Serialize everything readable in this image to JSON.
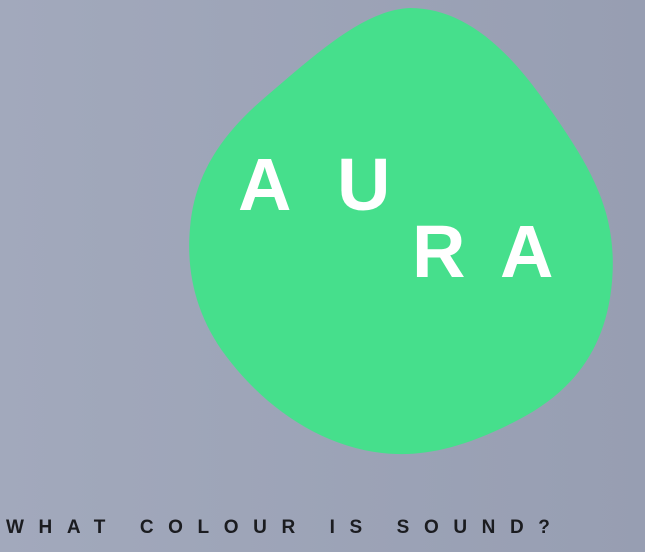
{
  "logo": {
    "letters": [
      "A",
      "U",
      "R",
      "A"
    ],
    "blob_color": "#46df8c",
    "text_color": "#ffffff"
  },
  "tagline": "WHAT COLOUR IS SOUND?",
  "colors": {
    "background_left": "#a2a9bc",
    "background_right": "#979eb2",
    "tagline": "#1b1c20"
  }
}
